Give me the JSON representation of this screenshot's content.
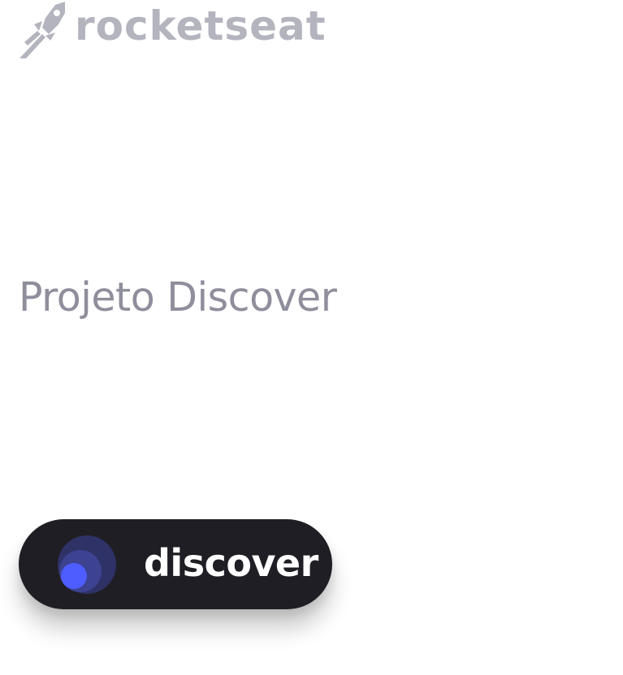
{
  "brand": {
    "logo_text": "rocketseat",
    "logo_color": "#b4b4bf"
  },
  "main": {
    "title": "Projeto Discover",
    "title_color": "#8e8e9c"
  },
  "badge": {
    "label": "discover",
    "background": "#1f1e24",
    "icon": "discover-logo-icon",
    "icon_colors": [
      "#2e3267",
      "#3d4291",
      "#4e5dff"
    ]
  }
}
